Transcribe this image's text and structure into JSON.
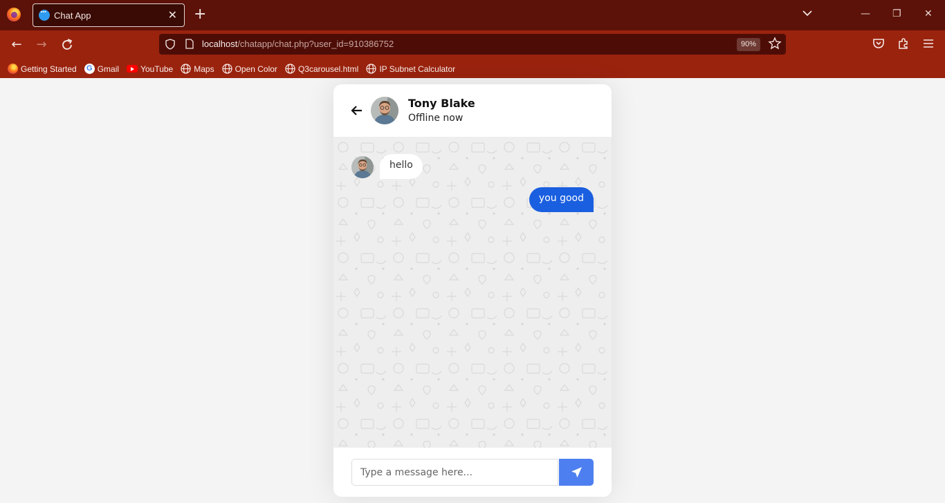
{
  "browser": {
    "tab_title": "Chat App",
    "url_host": "localhost",
    "url_path": "/chatapp/chat.php?user_id=910386752",
    "zoom": "90%",
    "bookmarks": [
      {
        "label": "Getting Started",
        "icon": "firefox-icon"
      },
      {
        "label": "Gmail",
        "icon": "google-icon"
      },
      {
        "label": "YouTube",
        "icon": "youtube-icon"
      },
      {
        "label": "Maps",
        "icon": "globe-icon"
      },
      {
        "label": "Open Color",
        "icon": "globe-icon"
      },
      {
        "label": "Q3carousel.html",
        "icon": "globe-icon"
      },
      {
        "label": "IP Subnet Calculator",
        "icon": "globe-icon"
      }
    ]
  },
  "chat": {
    "user_name": "Tony Blake",
    "status": "Offline now",
    "messages": [
      {
        "direction": "incoming",
        "text": "hello"
      },
      {
        "direction": "outgoing",
        "text": "you good"
      }
    ],
    "input_placeholder": "Type a message here..."
  },
  "colors": {
    "tabbar": "#5c1208",
    "toolbar": "#9a230e",
    "outgoing_bubble": "#1a5fe0",
    "send_button": "#4d7ff0"
  }
}
